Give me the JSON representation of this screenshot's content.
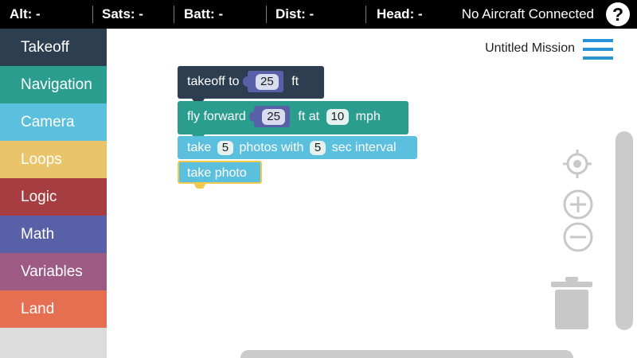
{
  "status_bar": {
    "alt": "Alt: -",
    "sats": "Sats: -",
    "batt": "Batt: -",
    "dist": "Dist: -",
    "head": "Head: -",
    "connection": "No Aircraft Connected",
    "help_label": "?"
  },
  "sidebar": {
    "items": [
      {
        "label": "Takeoff",
        "color": "#2c3e50"
      },
      {
        "label": "Navigation",
        "color": "#2a9d8f"
      },
      {
        "label": "Camera",
        "color": "#5bc0de"
      },
      {
        "label": "Loops",
        "color": "#e9c46a"
      },
      {
        "label": "Logic",
        "color": "#a63d40"
      },
      {
        "label": "Math",
        "color": "#5860a8"
      },
      {
        "label": "Variables",
        "color": "#9c5a85"
      },
      {
        "label": "Land",
        "color": "#e76f51"
      }
    ]
  },
  "workspace": {
    "mission_title": "Untitled Mission",
    "blocks": {
      "takeoff": {
        "prefix": "takeoff to",
        "value": "25",
        "suffix": "ft"
      },
      "fly": {
        "prefix": "fly forward",
        "distance": "25",
        "middle": "ft at",
        "speed": "10",
        "suffix": "mph"
      },
      "photos": {
        "prefix": "take",
        "count": "5",
        "middle": "photos with",
        "interval": "5",
        "suffix": "sec interval"
      },
      "photo": {
        "label": "take photo"
      }
    }
  },
  "tools": {
    "recenter_icon": "crosshair-icon",
    "zoom_in_icon": "plus-circle-icon",
    "zoom_out_icon": "minus-circle-icon",
    "trash_icon": "trash-icon"
  }
}
